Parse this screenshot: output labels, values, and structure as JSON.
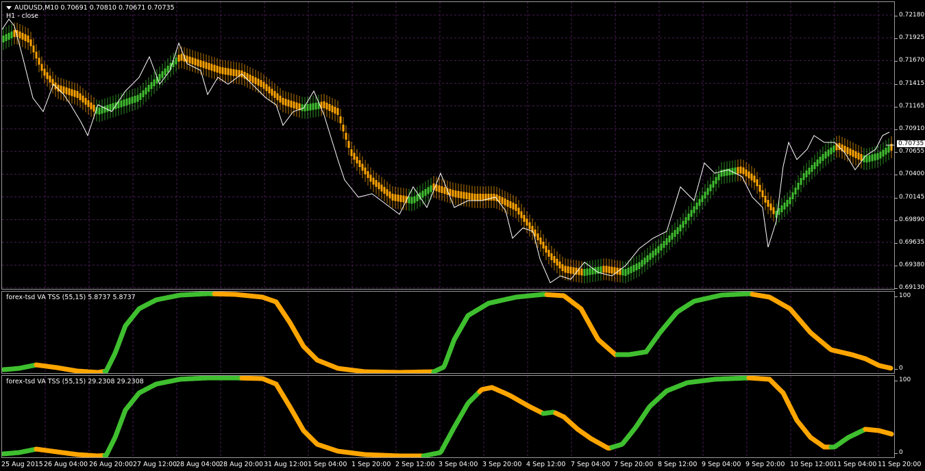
{
  "main_pane": {
    "symbol_header": "AUDUSD,M10  0.70691 0.70810 0.70671 0.70735",
    "indicator_label": "H1 - close",
    "price_ticks": [
      "0.72180",
      "0.71925",
      "0.71670",
      "0.71415",
      "0.71165",
      "0.70910",
      "0.70655",
      "0.70400",
      "0.70145",
      "0.69890",
      "0.69635",
      "0.69380",
      "0.69130"
    ],
    "current_price": "0.70735"
  },
  "indicator_1": {
    "title": "forex-tsd VA TSS (55,15) 5.8737 5.8737",
    "scale_top": "100",
    "scale_bottom": "0"
  },
  "indicator_2": {
    "title": "forex-tsd VA TSS (55,15) 29.2308 29.2308",
    "scale_top": "100",
    "scale_bottom": "0"
  },
  "time_axis": [
    "25 Aug 2015",
    "26 Aug 04:00",
    "26 Aug 20:00",
    "27 Aug 12:00",
    "28 Aug 04:00",
    "28 Aug 20:00",
    "31 Aug 12:00",
    "1 Sep 04:00",
    "1 Sep 20:00",
    "2 Sep 12:00",
    "3 Sep 04:00",
    "3 Sep 20:00",
    "4 Sep 12:00",
    "7 Sep 04:00",
    "7 Sep 20:00",
    "8 Sep 12:00",
    "9 Sep 04:00",
    "9 Sep 20:00",
    "10 Sep 12:00",
    "11 Sep 04:00",
    "11 Sep 20:00"
  ],
  "colors": {
    "up": "#3fbf2f",
    "down": "#ffa500",
    "grid": "#4a1d55",
    "close_line": "#ffffff"
  }
}
